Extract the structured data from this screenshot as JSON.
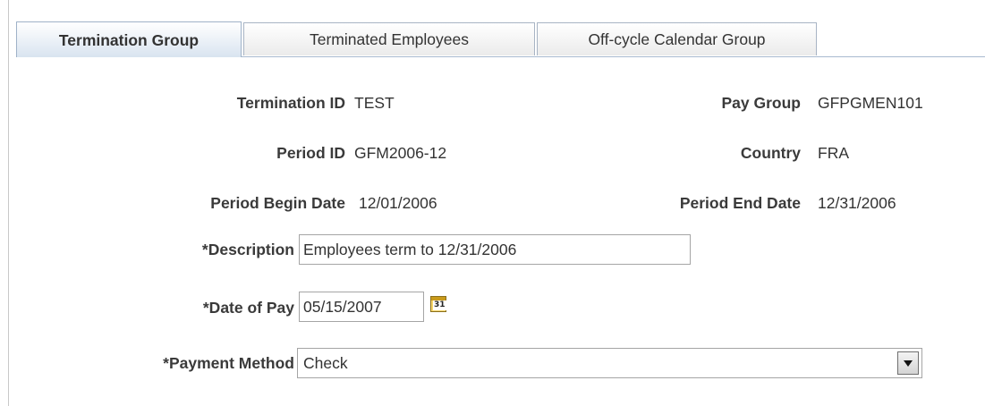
{
  "tabs": [
    {
      "label": "Termination Group",
      "active": true
    },
    {
      "label": "Terminated Employees",
      "active": false
    },
    {
      "label": "Off-cycle Calendar Group",
      "active": false
    }
  ],
  "form": {
    "termination_id": {
      "label": "Termination ID",
      "value": "TEST"
    },
    "pay_group": {
      "label": "Pay Group",
      "value": "GFPGMEN101"
    },
    "period_id": {
      "label": "Period ID",
      "value": "GFM2006-12"
    },
    "country": {
      "label": "Country",
      "value": "FRA"
    },
    "period_begin_date": {
      "label": "Period Begin Date",
      "value": "12/01/2006"
    },
    "period_end_date": {
      "label": "Period End Date",
      "value": "12/31/2006"
    },
    "description": {
      "label": "*Description",
      "value": "Employees term to 12/31/2006"
    },
    "date_of_pay": {
      "label": "*Date of Pay",
      "value": "05/15/2007"
    },
    "payment_method": {
      "label": "*Payment Method",
      "value": "Check"
    }
  },
  "icons": {
    "calendar": {
      "name": "calendar-icon",
      "text": "31"
    },
    "dropdown": {
      "name": "chevron-down-icon"
    }
  }
}
